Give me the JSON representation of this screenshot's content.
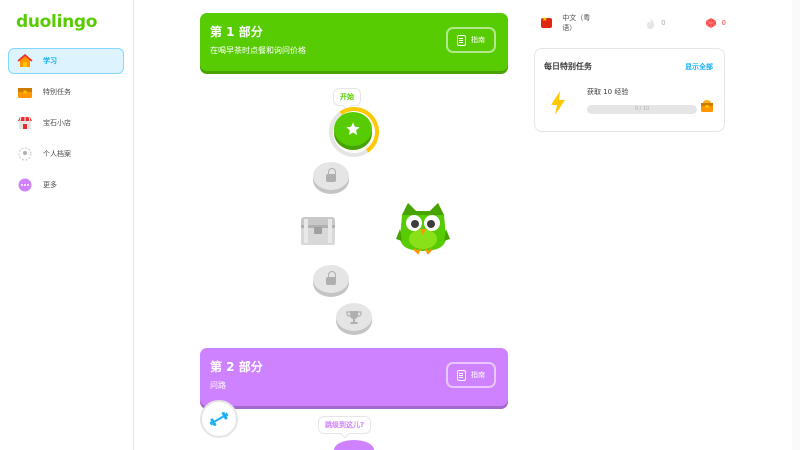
{
  "brand": {
    "logo": "duolingo",
    "color": "#58cc02"
  },
  "sidebar": {
    "items": [
      {
        "label": "学习",
        "icon": "home-icon",
        "active": true
      },
      {
        "label": "特别任务",
        "icon": "quest-chest-icon",
        "active": false
      },
      {
        "label": "宝石小店",
        "icon": "shop-icon",
        "active": false
      },
      {
        "label": "个人档案",
        "icon": "profile-icon",
        "active": false
      },
      {
        "label": "更多",
        "icon": "more-icon",
        "active": false
      }
    ]
  },
  "path": {
    "units": [
      {
        "title": "第 1 部分",
        "subtitle": "在喝早茶时点餐和询问价格",
        "guide_label": "指南",
        "color": "#58cc02"
      },
      {
        "title": "第 2 部分",
        "subtitle": "问路",
        "guide_label": "指南",
        "color": "#ce82ff"
      }
    ],
    "start_bubble": "开始",
    "where_bubble": "跳级到这儿?"
  },
  "topbar": {
    "language": "中文（粤语）",
    "streak": "0",
    "gems": "0"
  },
  "quests": {
    "title": "每日特别任务",
    "view_all": "显示全部",
    "items": [
      {
        "name": "获取 10 经验",
        "progress_text": "0 / 10",
        "progress": 0.0
      }
    ]
  },
  "colors": {
    "accent_blue": "#1cb0f6",
    "locked_gray": "#e5e5e5",
    "gold": "#ffc800",
    "unit2_purple": "#ce82ff"
  }
}
